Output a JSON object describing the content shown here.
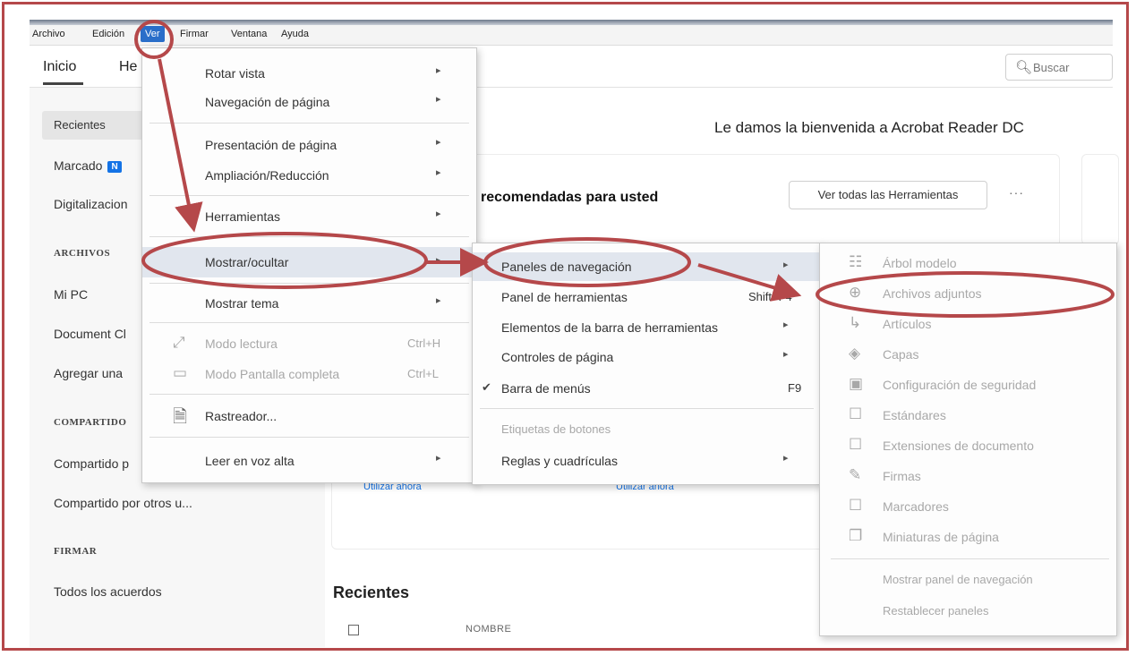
{
  "menubar": {
    "items": [
      {
        "label": "Archivo"
      },
      {
        "label": "Edición"
      },
      {
        "label": "Ver"
      },
      {
        "label": "Firmar"
      },
      {
        "label": "Ventana"
      },
      {
        "label": "Ayuda"
      }
    ]
  },
  "tabs": {
    "inicio": "Inicio",
    "herramientas": "He"
  },
  "search": {
    "placeholder": "Buscar"
  },
  "sidebar": {
    "recientes": "Recientes",
    "marcado": "Marcado",
    "marcado_badge": "N",
    "digitalizaciones": "Digitalizacion",
    "sec_archivos": "ARCHIVOS",
    "mi_pc": "Mi PC",
    "document_cloud": "Document Cl",
    "agregar": "Agregar una",
    "sec_compartido": "COMPARTIDO",
    "compartido_usted": "Compartido p",
    "compartido_otros": "Compartido por otros u...",
    "sec_firmar": "FIRMAR",
    "acuerdos": "Todos los acuerdos"
  },
  "main": {
    "welcome": "Le damos la bienvenida a Acrobat Reader DC",
    "recommended": "recomendadas para usted",
    "view_all": "Ver todas las Herramientas",
    "more": "···",
    "use_now_1": "Utilizar ahora",
    "use_now_2": "Utilizar ahora",
    "recent_title": "Recientes",
    "col_name": "NOMBRE"
  },
  "menu_ver": {
    "rotar": "Rotar vista",
    "navegacion": "Navegación de página",
    "presentacion": "Presentación de página",
    "ampliacion": "Ampliación/Reducción",
    "herramientas": "Herramientas",
    "mostrar_ocultar": "Mostrar/ocultar",
    "mostrar_tema": "Mostrar tema",
    "modo_lectura": "Modo lectura",
    "modo_lectura_sc": "Ctrl+H",
    "pantalla_completa": "Modo Pantalla completa",
    "pantalla_completa_sc": "Ctrl+L",
    "rastreador": "Rastreador...",
    "leer_voz_alta": "Leer en voz alta"
  },
  "menu_mostrar": {
    "paneles_nav": "Paneles de navegación",
    "panel_herramientas": "Panel de herramientas",
    "panel_herramientas_sc": "Shift+F4",
    "elementos_barra": "Elementos de la barra de herramientas",
    "controles_pagina": "Controles de página",
    "barra_menus": "Barra de menús",
    "barra_menus_sc": "F9",
    "etiquetas_botones": "Etiquetas de botones",
    "reglas": "Reglas y cuadrículas"
  },
  "menu_paneles": {
    "arbol": "Árbol modelo",
    "adjuntos": "Archivos adjuntos",
    "articulos": "Artículos",
    "capas": "Capas",
    "seguridad": "Configuración de seguridad",
    "estandares": "Estándares",
    "extensiones": "Extensiones de documento",
    "firmas": "Firmas",
    "marcadores": "Marcadores",
    "miniaturas": "Miniaturas de página",
    "mostrar_panel": "Mostrar panel de navegación",
    "restablecer": "Restablecer paneles"
  },
  "colors": {
    "annotation": "#b5484a",
    "accent": "#1473e6",
    "active_menu": "#2a6ec9"
  }
}
